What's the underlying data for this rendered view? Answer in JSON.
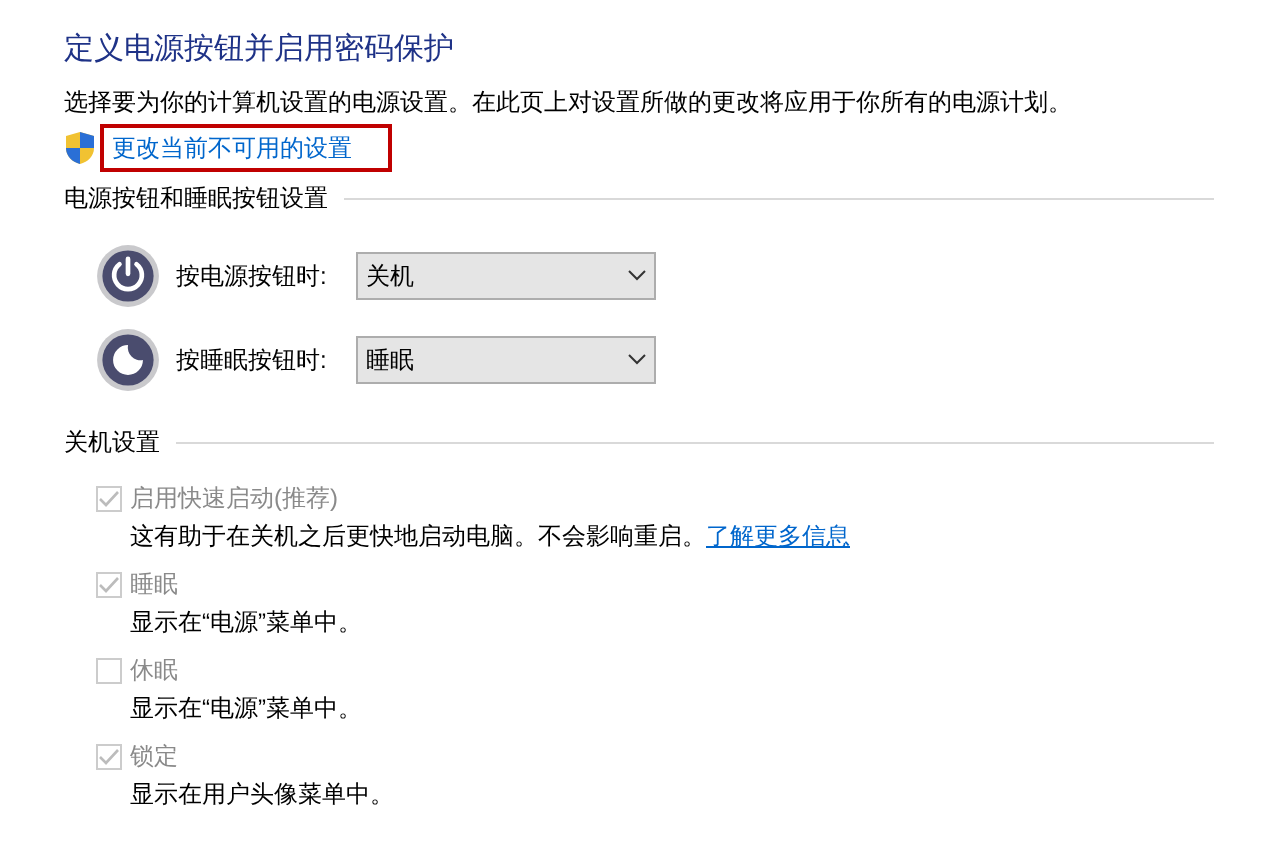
{
  "title": "定义电源按钮并启用密码保护",
  "intro": "选择要为你的计算机设置的电源设置。在此页上对设置所做的更改将应用于你所有的电源计划。",
  "change_link": {
    "label": "更改当前不可用的设置",
    "highlighted": true
  },
  "buttons_section": {
    "heading": "电源按钮和睡眠按钮设置",
    "rows": [
      {
        "kind": "power",
        "label": "按电源按钮时:",
        "value": "关机"
      },
      {
        "kind": "sleep",
        "label": "按睡眠按钮时:",
        "value": "睡眠"
      }
    ]
  },
  "shutdown_section": {
    "heading": "关机设置",
    "options": [
      {
        "label": "启用快速启动(推荐)",
        "checked": true,
        "disabled": true,
        "description": "这有助于在关机之后更快地启动电脑。不会影响重启。",
        "link": "了解更多信息"
      },
      {
        "label": "睡眠",
        "checked": true,
        "disabled": true,
        "description": "显示在“电源”菜单中。"
      },
      {
        "label": "休眠",
        "checked": false,
        "disabled": true,
        "description": "显示在“电源”菜单中。"
      },
      {
        "label": "锁定",
        "checked": true,
        "disabled": true,
        "description": "显示在用户头像菜单中。"
      }
    ]
  }
}
